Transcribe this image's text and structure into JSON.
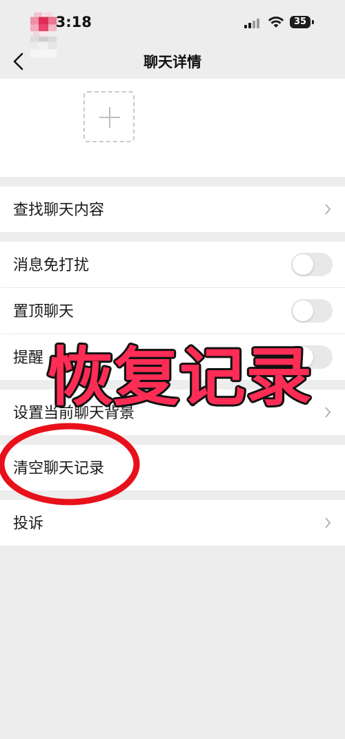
{
  "status_bar": {
    "time": "13:18",
    "battery": "35"
  },
  "nav": {
    "title": "聊天详情"
  },
  "menu": {
    "search": "查找聊天内容",
    "mute": "消息免打扰",
    "pin": "置顶聊天",
    "remind": "提醒",
    "background": "设置当前聊天背景",
    "clear": "清空聊天记录",
    "report": "投诉"
  },
  "overlay": {
    "text": "恢复记录"
  },
  "colors": {
    "accent": "#ff2d55",
    "oval": "#e8101a",
    "background": "#ededed"
  },
  "toggles": {
    "mute": false,
    "pin": false,
    "remind": false
  }
}
